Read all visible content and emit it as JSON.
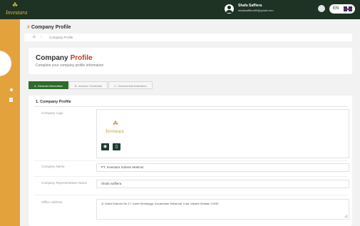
{
  "header": {
    "brand": "Investara",
    "user_name": "Shafa Saffiera",
    "user_email": "shafasaffiera99@gmail.com",
    "language": "EN"
  },
  "page": {
    "title": "Company Profile",
    "breadcrumb": [
      "Company Profile"
    ]
  },
  "heading": {
    "title_main": "Company",
    "title_accent": "Profile",
    "subtitle": "Complete your company profile information"
  },
  "tabs": [
    {
      "label": "A. General Information",
      "active": true
    },
    {
      "label": "B. Investor Credential",
      "active": false
    },
    {
      "label": "C. General Administration",
      "active": false
    }
  ],
  "form": {
    "section_title": "1. Company Profile",
    "logo_label": "Company Logo",
    "logo_brand": "Investara",
    "name_label": "Company Name",
    "name_value": "PT. Investara Sukses Makmur",
    "rep_label": "Company Representative Name",
    "rep_value": "Shafa Saffiera",
    "address_label": "Office Address",
    "address_value": "Jl. Gatot Subroto No.17, Karet Semanggi, Kecamatan Setiabudi, Kota Jakarta Selatan 12930"
  },
  "colors": {
    "topbar": "#1e3323",
    "sidebar": "#e4a23d",
    "active_tab": "#2e6b2c",
    "accent": "#c0392b"
  },
  "icons": [
    "home-icon",
    "user-avatar-icon",
    "settings-icon",
    "uk-flag-icon",
    "view-icon",
    "delete-icon"
  ]
}
